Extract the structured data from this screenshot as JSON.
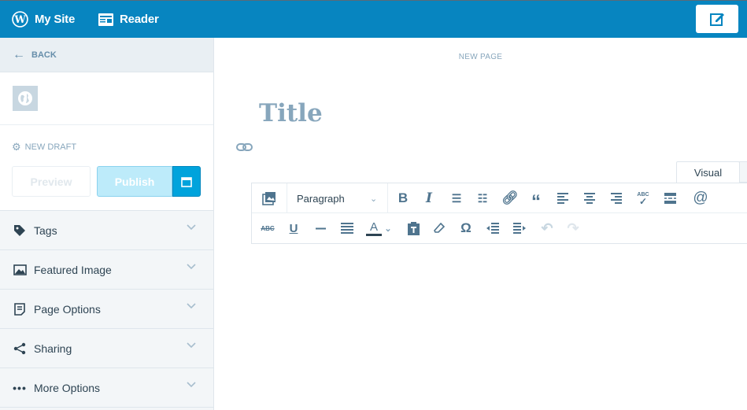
{
  "topbar": {
    "my_site": "My Site",
    "reader": "Reader",
    "brand_color": "#0785c0"
  },
  "sidebar": {
    "back": "BACK",
    "draft_status": "NEW DRAFT",
    "preview": "Preview",
    "publish": "Publish",
    "sections": [
      {
        "label": "Tags",
        "icon": "tag-icon"
      },
      {
        "label": "Featured Image",
        "icon": "image-icon"
      },
      {
        "label": "Page Options",
        "icon": "page-icon"
      },
      {
        "label": "Sharing",
        "icon": "share-icon"
      },
      {
        "label": "More Options",
        "icon": "ellipsis-icon"
      }
    ]
  },
  "editor": {
    "page_label": "NEW PAGE",
    "title_placeholder": "Title",
    "tabs": [
      "Visual"
    ],
    "format_select": "Paragraph",
    "spellcheck_label": "ABC",
    "strikethrough_label": "ABC",
    "text_color_label": "A"
  }
}
